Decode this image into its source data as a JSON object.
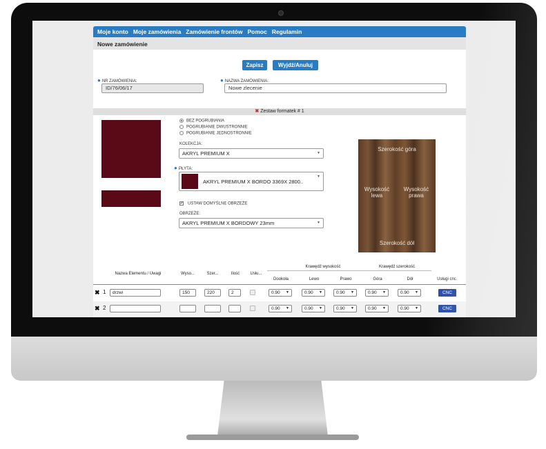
{
  "nav": {
    "items": [
      "Moje konto",
      "Moje zamówienia",
      "Zamówienie frontów",
      "Pomoc",
      "Regulamin"
    ]
  },
  "panel": {
    "title": "Nowe zamówienie"
  },
  "buttons": {
    "save": "Zapisz",
    "exit": "Wyjdź/Anuluj"
  },
  "order": {
    "number_label": "NR ZAMÓWIENIA:",
    "number_value": "ID/76/06/17",
    "name_label": "NAZWA ZAMÓWIENIA:",
    "name_value": "Nowe zlecenie"
  },
  "section": {
    "title": "Zestaw formatek # 1"
  },
  "options": {
    "radio": [
      "BEZ POGRUBIANIA",
      "POGRUBIANIE DWUSTRONNIE",
      "POGRUBIANIE JEDNOSTRONNIE"
    ],
    "kolekcja_label": "KOLEKCJA:",
    "kolekcja_value": "AKRYL PREMIUM X",
    "plyta_label": "PŁYTA:",
    "plyta_value": "AKRYL PREMIUM X BORDO 3369X 2800..",
    "default_edges_label": "USTAW DOMYŚLNE OBRZEŻE",
    "obrzeze_label": "OBRZEŻE:",
    "obrzeze_value": "AKRYL PREMIUM X BORDOWY 23mm",
    "swatch_color": "#5a0a16"
  },
  "preview": {
    "top": "Szerokość góra",
    "left": "Wysokość lewa",
    "right": "Wysokość prawa",
    "bottom": "Szerokość dół"
  },
  "table": {
    "headers": {
      "name": "Nazwa Elementu / Uwagi",
      "height": "Wyso...",
      "width": "Szer...",
      "qty": "Ilość",
      "services": "Usłu...",
      "around": "Dookoła",
      "group_height": "Krawędź wysokość",
      "left": "Lewo",
      "right": "Prawo",
      "group_width": "Krawędź szerokość",
      "top": "Góra",
      "bottom": "Dół",
      "cnc": "Usługi cnc"
    },
    "rows": [
      {
        "mark": "✖",
        "num": "1",
        "name": "drzwi",
        "height": "150",
        "width": "220",
        "qty": "2",
        "around": "0.90",
        "left": "0.90",
        "right": "0.90",
        "top": "0.90",
        "bottom": "0.90",
        "cnc": "CNC"
      },
      {
        "mark": "✖",
        "num": "2",
        "name": "",
        "height": "",
        "width": "",
        "qty": "",
        "around": "0.90",
        "left": "0.90",
        "right": "0.90",
        "top": "0.90",
        "bottom": "0.90",
        "cnc": "CNC"
      }
    ]
  }
}
